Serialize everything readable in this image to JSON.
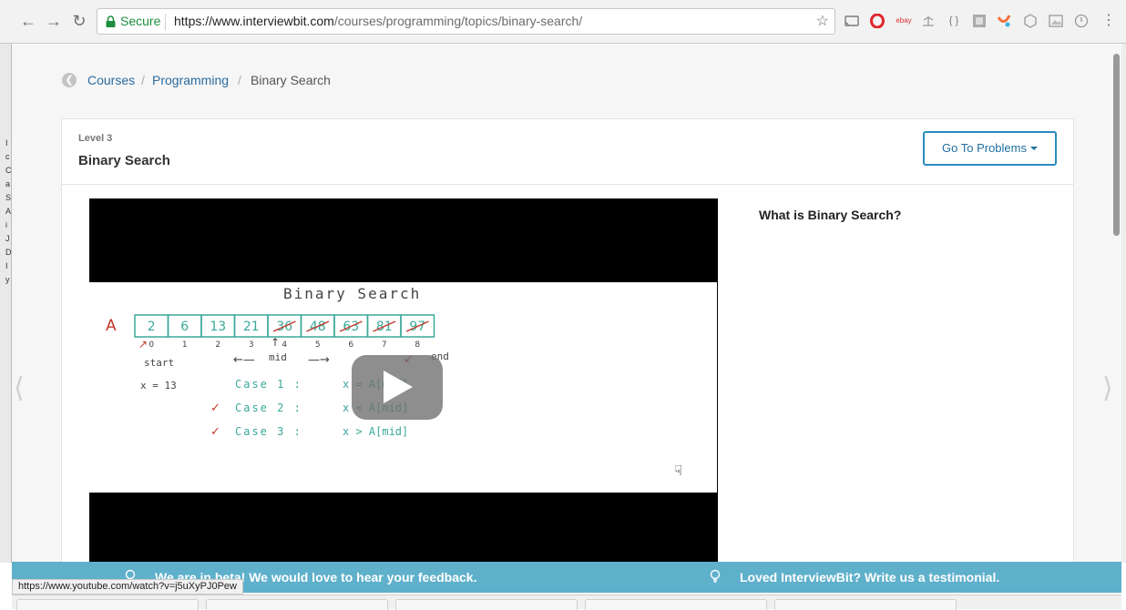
{
  "browser": {
    "secure_label": "Secure",
    "url_host": "https://www.interviewbit.com",
    "url_path": "/courses/programming/topics/binary-search/",
    "status_url": "https://www.youtube.com/watch?v=j5uXyPJ0Pew",
    "extensions": [
      "cast-icon",
      "opera-icon",
      "ebay-icon",
      "scale-icon",
      "json-icon",
      "ext-grey-icon",
      "ext-bird-icon",
      "ext-cube-icon",
      "ext-photo-icon",
      "ext-circle-icon",
      "menu-icon"
    ],
    "ebay_label": "ebay",
    "json_label": "{ }"
  },
  "breadcrumb": {
    "items": [
      "Courses",
      "Programming"
    ],
    "current": "Binary Search",
    "separator": "/"
  },
  "topic": {
    "level": "Level 3",
    "title": "Binary Search",
    "go_problems_label": "Go To Problems"
  },
  "video": {
    "whiteboard_title": "Binary Search",
    "array_name": "A",
    "cells": [
      "2",
      "6",
      "13",
      "21",
      "36",
      "48",
      "63",
      "81",
      "97"
    ],
    "crossed_from": 4,
    "indices": [
      "0",
      "1",
      "2",
      "3",
      "4",
      "5",
      "6",
      "7",
      "8"
    ],
    "labels": {
      "start": "start",
      "mid": "mid",
      "end": "end",
      "x": "x = 13"
    },
    "cases": [
      {
        "label": "Case 1 :",
        "expr": "x = A[mid]",
        "check": false
      },
      {
        "label": "Case 2 :",
        "expr": "x < A[mid]",
        "check": true
      },
      {
        "label": "Case 3 :",
        "expr": "x > A[mid]",
        "check": true
      }
    ]
  },
  "content": {
    "question": "What is Binary Search?"
  },
  "feedback": {
    "beta_text": "We are in beta! We would love to hear your feedback.",
    "testimonial_text": "Loved InterviewBit? Write us a testimonial."
  },
  "colors": {
    "accent": "#2a8bc0",
    "link": "#2a6ba0",
    "feedback_bar": "#5fb0cb",
    "secure_green": "#1e8e3e",
    "board_teal": "#3aa89a",
    "board_red": "#c0392b",
    "board_dark": "#444444"
  }
}
